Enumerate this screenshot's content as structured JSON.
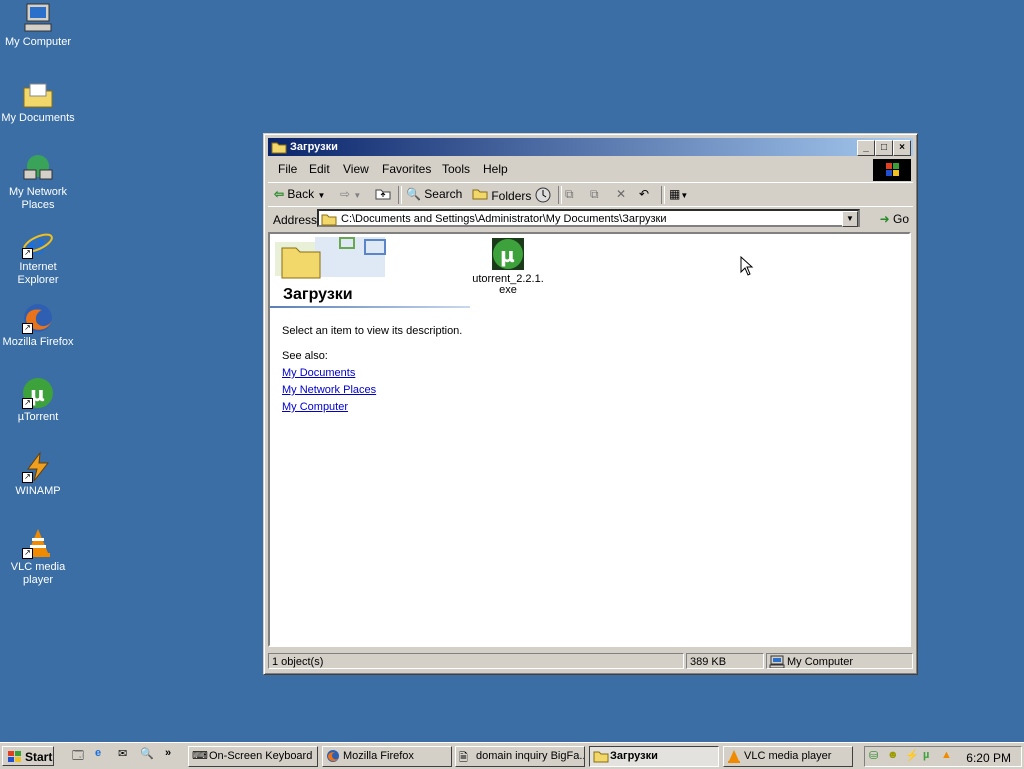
{
  "desktop": {
    "icons": [
      {
        "label": "My Computer",
        "icon": "my-computer-icon"
      },
      {
        "label": "My Documents",
        "icon": "my-documents-icon"
      },
      {
        "label": "My Network Places",
        "icon": "network-places-icon"
      },
      {
        "label": "Internet Explorer",
        "icon": "internet-explorer-icon"
      },
      {
        "label": "Mozilla Firefox",
        "icon": "firefox-icon"
      },
      {
        "label": "µTorrent",
        "icon": "utorrent-icon"
      },
      {
        "label": "WINAMP",
        "icon": "winamp-icon"
      },
      {
        "label": "VLC media player",
        "icon": "vlc-icon"
      }
    ]
  },
  "window": {
    "title": "Загрузки",
    "menu": [
      "File",
      "Edit",
      "View",
      "Favorites",
      "Tools",
      "Help"
    ],
    "toolbar": {
      "back": "Back",
      "search": "Search",
      "folders": "Folders"
    },
    "address": {
      "label": "Address",
      "value": "C:\\Documents and Settings\\Administrator\\My Documents\\Загрузки",
      "go": "Go"
    },
    "left_pane": {
      "folder_title": "Загрузки",
      "description": "Select an item to view its description.",
      "see_also": "See also:",
      "links": [
        "My Documents",
        "My Network Places",
        "My Computer"
      ]
    },
    "files": [
      {
        "name": "utorrent_2.2.1.exe",
        "icon": "utorrent-icon"
      }
    ],
    "status": {
      "objects": "1 object(s)",
      "size": "389 KB",
      "zone": "My Computer"
    }
  },
  "taskbar": {
    "start": "Start",
    "tasks": [
      {
        "label": "On-Screen Keyboard",
        "icon": "keyboard-icon",
        "active": false
      },
      {
        "label": "Mozilla Firefox",
        "icon": "firefox-icon",
        "active": false
      },
      {
        "label": "domain inquiry BigFa...",
        "icon": "document-icon",
        "active": false
      },
      {
        "label": "Загрузки",
        "icon": "folder-icon",
        "active": true
      },
      {
        "label": "VLC media player",
        "icon": "vlc-icon",
        "active": false
      }
    ],
    "clock": "6:20 PM"
  },
  "colors": {
    "desktop": "#3a6ea5",
    "titlebar_start": "#0a246a",
    "titlebar_end": "#a6caf0",
    "face": "#d4d0c8"
  }
}
